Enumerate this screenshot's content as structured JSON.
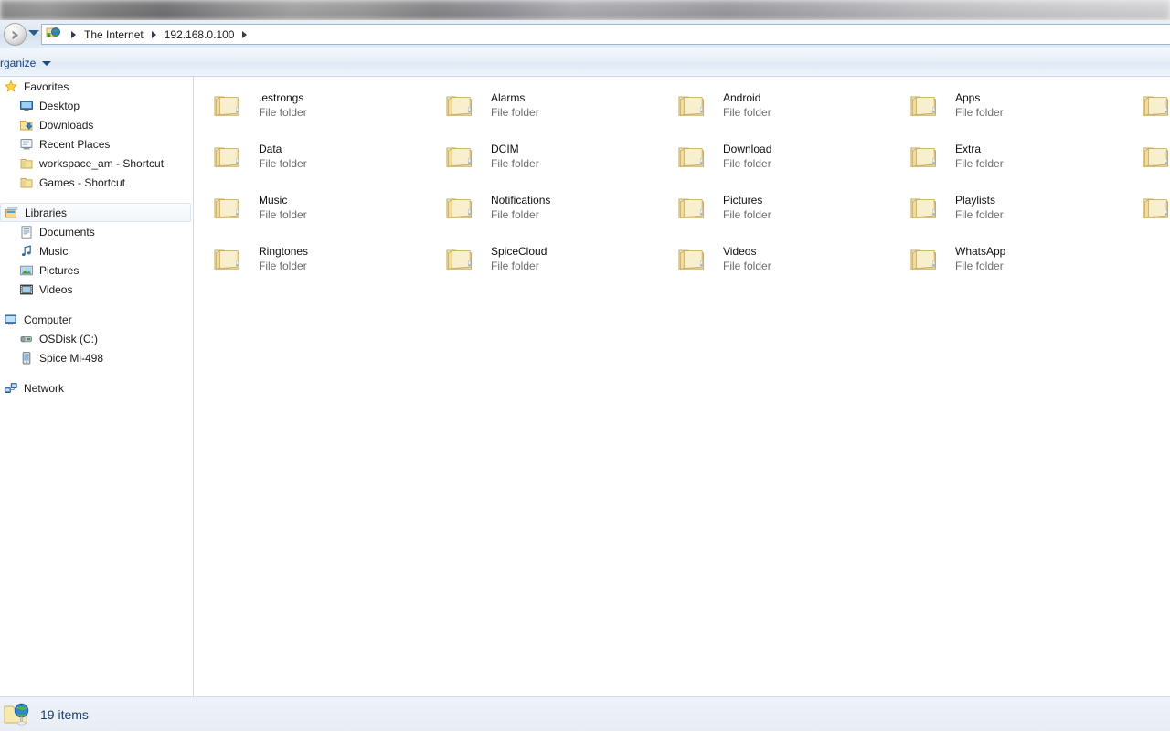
{
  "window": {
    "titlebar_visible": false
  },
  "navigation": {
    "forward_icon": "forward-arrow-icon",
    "history_dropdown_icon": "chevron-down-icon",
    "address_icon": "internet-globe-icon",
    "breadcrumbs": [
      {
        "label": "The Internet"
      },
      {
        "label": "192.168.0.100"
      }
    ]
  },
  "toolbar": {
    "organize_label": "rganize",
    "organize_caret_icon": "caret-down-icon"
  },
  "sidebar": {
    "groups": [
      {
        "header": {
          "label": "Favorites",
          "icon": "star-icon"
        },
        "items": [
          {
            "label": "Desktop",
            "icon": "desktop-icon"
          },
          {
            "label": "Downloads",
            "icon": "downloads-folder-icon"
          },
          {
            "label": "Recent Places",
            "icon": "recent-places-icon"
          },
          {
            "label": "workspace_am - Shortcut",
            "icon": "folder-shortcut-icon"
          },
          {
            "label": "Games - Shortcut",
            "icon": "folder-shortcut-icon"
          }
        ]
      },
      {
        "header": {
          "label": "Libraries",
          "icon": "libraries-icon",
          "selected": true
        },
        "items": [
          {
            "label": "Documents",
            "icon": "documents-library-icon"
          },
          {
            "label": "Music",
            "icon": "music-library-icon"
          },
          {
            "label": "Pictures",
            "icon": "pictures-library-icon"
          },
          {
            "label": "Videos",
            "icon": "videos-library-icon"
          }
        ]
      },
      {
        "header": {
          "label": "Computer",
          "icon": "computer-icon"
        },
        "items": [
          {
            "label": "OSDisk (C:)",
            "icon": "hard-disk-icon"
          },
          {
            "label": "Spice Mi-498",
            "icon": "portable-device-icon"
          }
        ]
      },
      {
        "header": {
          "label": "Network",
          "icon": "network-icon"
        },
        "items": []
      }
    ]
  },
  "files": {
    "type_label": "File folder",
    "items": [
      {
        "name": ".estrongs",
        "type": "File folder",
        "icon": "folder-icon"
      },
      {
        "name": "Alarms",
        "type": "File folder",
        "icon": "folder-icon"
      },
      {
        "name": "Android",
        "type": "File folder",
        "icon": "folder-icon"
      },
      {
        "name": "Apps",
        "type": "File folder",
        "icon": "folder-icon"
      },
      {
        "name": "",
        "type": "",
        "icon": "folder-icon"
      },
      {
        "name": "Data",
        "type": "File folder",
        "icon": "folder-icon"
      },
      {
        "name": "DCIM",
        "type": "File folder",
        "icon": "folder-icon"
      },
      {
        "name": "Download",
        "type": "File folder",
        "icon": "folder-icon"
      },
      {
        "name": "Extra",
        "type": "File folder",
        "icon": "folder-icon"
      },
      {
        "name": "",
        "type": "",
        "icon": "folder-icon"
      },
      {
        "name": "Music",
        "type": "File folder",
        "icon": "folder-icon"
      },
      {
        "name": "Notifications",
        "type": "File folder",
        "icon": "folder-icon"
      },
      {
        "name": "Pictures",
        "type": "File folder",
        "icon": "folder-icon"
      },
      {
        "name": "Playlists",
        "type": "File folder",
        "icon": "folder-icon"
      },
      {
        "name": "",
        "type": "",
        "icon": "folder-icon"
      },
      {
        "name": "Ringtones",
        "type": "File folder",
        "icon": "folder-icon"
      },
      {
        "name": "SpiceCloud",
        "type": "File folder",
        "icon": "folder-icon"
      },
      {
        "name": "Videos",
        "type": "File folder",
        "icon": "folder-icon"
      },
      {
        "name": "WhatsApp",
        "type": "File folder",
        "icon": "folder-icon"
      }
    ]
  },
  "status": {
    "icon": "network-folder-icon",
    "text": "19 items"
  },
  "colors": {
    "accent_blue": "#15428b",
    "folder_yellow": "#f5e6a8",
    "status_text": "#1d3d6b",
    "pane_divider": "#cfdce8"
  }
}
